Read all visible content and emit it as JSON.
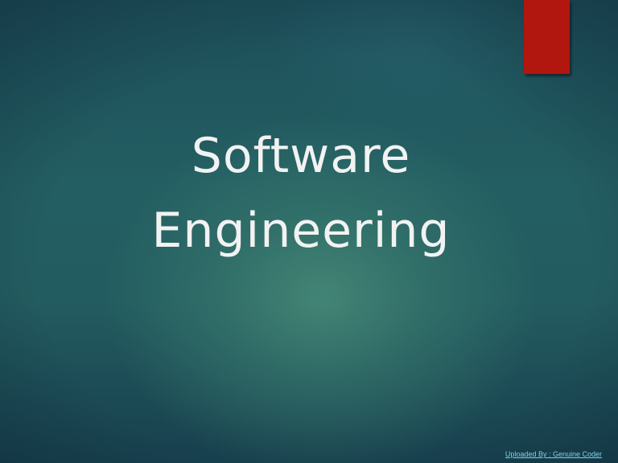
{
  "slide": {
    "title_line1": "Software",
    "title_line2": "Engineering",
    "credit_text": "Uploaded By : Genuine Coder"
  },
  "colors": {
    "background": "#235e62",
    "accent_bar": "#b1160f",
    "title_text": "#f2f2f2",
    "credit_link": "#7fd3e6"
  }
}
